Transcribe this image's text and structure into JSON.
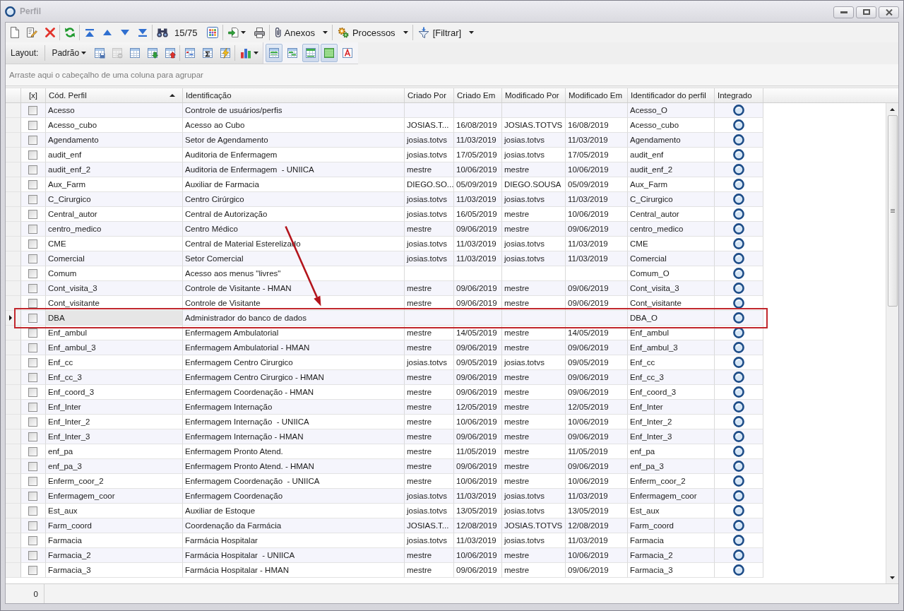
{
  "window": {
    "title": "Perfil"
  },
  "toolbar": {
    "counter": "15/75",
    "menus": [
      {
        "kind": "attachments",
        "label": "Anexos"
      },
      {
        "kind": "processes",
        "label": "Processos"
      },
      {
        "kind": "filter",
        "label": "[Filtrar]"
      }
    ]
  },
  "layout_bar": {
    "label": "Layout:",
    "layout": "Padrão",
    "tools": [
      {
        "kind": "save",
        "disabled": false
      },
      {
        "kind": "remove",
        "disabled": true
      },
      {
        "kind": "table",
        "disabled": false
      },
      {
        "kind": "import",
        "disabled": false
      },
      {
        "kind": "export",
        "disabled": false
      }
    ],
    "view_toggles": [
      {
        "kind": "grid",
        "pressed": true
      },
      {
        "kind": "bands",
        "pressed": false
      },
      {
        "kind": "header",
        "pressed": true
      },
      {
        "kind": "fill",
        "pressed": true
      },
      {
        "kind": "font",
        "pressed": false
      }
    ]
  },
  "group_panel": {
    "hint": "Arraste aqui o cabeçalho de uma coluna para agrupar"
  },
  "grid": {
    "columns": [
      {
        "label": "[x]",
        "sorted": false
      },
      {
        "label": "Cód. Perfil",
        "sorted": true
      },
      {
        "label": "Identificação",
        "sorted": false
      },
      {
        "label": "Criado Por",
        "sorted": false
      },
      {
        "label": "Criado Em",
        "sorted": false
      },
      {
        "label": "Modificado Por",
        "sorted": false
      },
      {
        "label": "Modificado Em",
        "sorted": false
      },
      {
        "label": "Identificador do perfil",
        "sorted": false
      },
      {
        "label": "Integrado",
        "sorted": false
      }
    ],
    "rows": [
      {
        "code": "Acesso",
        "name": "Controle de usuários/perfis",
        "profile_id": "Acesso_O",
        "checked": false,
        "integrated": true,
        "selected": false,
        "highlighted": false
      },
      {
        "code": "Acesso_cubo",
        "name": "Acesso ao Cubo",
        "created_by": "JOSIAS.T...",
        "created_on": "16/08/2019",
        "modified_by": "JOSIAS.TOTVS",
        "modified_on": "16/08/2019",
        "profile_id": "Acesso_cubo",
        "checked": false,
        "integrated": true,
        "selected": false,
        "highlighted": false
      },
      {
        "code": "Agendamento",
        "name": "Setor de Agendamento",
        "created_by": "josias.totvs",
        "created_on": "11/03/2019",
        "modified_by": "josias.totvs",
        "modified_on": "11/03/2019",
        "profile_id": "Agendamento",
        "checked": false,
        "integrated": true,
        "selected": false,
        "highlighted": false
      },
      {
        "code": "audit_enf",
        "name": "Auditoria de Enfermagem",
        "created_by": "josias.totvs",
        "created_on": "17/05/2019",
        "modified_by": "josias.totvs",
        "modified_on": "17/05/2019",
        "profile_id": "audit_enf",
        "checked": false,
        "integrated": true,
        "selected": false,
        "highlighted": false
      },
      {
        "code": "audit_enf_2",
        "name": "Auditoria de Enfermagem  - UNIICA",
        "created_by": "mestre",
        "created_on": "10/06/2019",
        "modified_by": "mestre",
        "modified_on": "10/06/2019",
        "profile_id": "audit_enf_2",
        "checked": false,
        "integrated": true,
        "selected": false,
        "highlighted": false
      },
      {
        "code": "Aux_Farm",
        "name": "Auxiliar de Farmacia",
        "created_by": "DIEGO.SO...",
        "created_on": "05/09/2019",
        "modified_by": "DIEGO.SOUSA",
        "modified_on": "05/09/2019",
        "profile_id": "Aux_Farm",
        "checked": false,
        "integrated": true,
        "selected": false,
        "highlighted": false
      },
      {
        "code": "C_Cirurgico",
        "name": "Centro Cirúrgico",
        "created_by": "josias.totvs",
        "created_on": "11/03/2019",
        "modified_by": "josias.totvs",
        "modified_on": "11/03/2019",
        "profile_id": "C_Cirurgico",
        "checked": false,
        "integrated": true,
        "selected": false,
        "highlighted": false
      },
      {
        "code": "Central_autor",
        "name": "Central de Autorização",
        "created_by": "josias.totvs",
        "created_on": "16/05/2019",
        "modified_by": "mestre",
        "modified_on": "10/06/2019",
        "profile_id": "Central_autor",
        "checked": false,
        "integrated": true,
        "selected": false,
        "highlighted": false
      },
      {
        "code": "centro_medico",
        "name": "Centro Médico",
        "created_by": "mestre",
        "created_on": "09/06/2019",
        "modified_by": "mestre",
        "modified_on": "09/06/2019",
        "profile_id": "centro_medico",
        "checked": false,
        "integrated": true,
        "selected": false,
        "highlighted": false
      },
      {
        "code": "CME",
        "name": "Central de Material Esterelizado",
        "created_by": "josias.totvs",
        "created_on": "11/03/2019",
        "modified_by": "josias.totvs",
        "modified_on": "11/03/2019",
        "profile_id": "CME",
        "checked": false,
        "integrated": true,
        "selected": false,
        "highlighted": false
      },
      {
        "code": "Comercial",
        "name": "Setor Comercial",
        "created_by": "josias.totvs",
        "created_on": "11/03/2019",
        "modified_by": "josias.totvs",
        "modified_on": "11/03/2019",
        "profile_id": "Comercial",
        "checked": false,
        "integrated": true,
        "selected": false,
        "highlighted": false
      },
      {
        "code": "Comum",
        "name": "Acesso aos menus \"livres\"",
        "profile_id": "Comum_O",
        "checked": false,
        "integrated": true,
        "selected": false,
        "highlighted": false
      },
      {
        "code": "Cont_visita_3",
        "name": "Controle de Visitante - HMAN",
        "created_by": "mestre",
        "created_on": "09/06/2019",
        "modified_by": "mestre",
        "modified_on": "09/06/2019",
        "profile_id": "Cont_visita_3",
        "checked": false,
        "integrated": true,
        "selected": false,
        "highlighted": false
      },
      {
        "code": "Cont_visitante",
        "name": "Controle de Visitante",
        "created_by": "mestre",
        "created_on": "09/06/2019",
        "modified_by": "mestre",
        "modified_on": "09/06/2019",
        "profile_id": "Cont_visitante",
        "checked": false,
        "integrated": true,
        "selected": false,
        "highlighted": false
      },
      {
        "code": "DBA",
        "name": "Administrador do banco de dados",
        "profile_id": "DBA_O",
        "checked": false,
        "integrated": true,
        "selected": true,
        "highlighted": true
      },
      {
        "code": "Enf_ambul",
        "name": "Enfermagem Ambulatorial",
        "created_by": "mestre",
        "created_on": "14/05/2019",
        "modified_by": "mestre",
        "modified_on": "14/05/2019",
        "profile_id": "Enf_ambul",
        "checked": false,
        "integrated": true,
        "selected": false,
        "highlighted": false
      },
      {
        "code": "Enf_ambul_3",
        "name": "Enfermagem Ambulatorial - HMAN",
        "created_by": "mestre",
        "created_on": "09/06/2019",
        "modified_by": "mestre",
        "modified_on": "09/06/2019",
        "profile_id": "Enf_ambul_3",
        "checked": false,
        "integrated": true,
        "selected": false,
        "highlighted": false
      },
      {
        "code": "Enf_cc",
        "name": "Enfermagem Centro Cirurgico",
        "created_by": "josias.totvs",
        "created_on": "09/05/2019",
        "modified_by": "josias.totvs",
        "modified_on": "09/05/2019",
        "profile_id": "Enf_cc",
        "checked": false,
        "integrated": true,
        "selected": false,
        "highlighted": false
      },
      {
        "code": "Enf_cc_3",
        "name": "Enfermagem Centro Cirurgico - HMAN",
        "created_by": "mestre",
        "created_on": "09/06/2019",
        "modified_by": "mestre",
        "modified_on": "09/06/2019",
        "profile_id": "Enf_cc_3",
        "checked": false,
        "integrated": true,
        "selected": false,
        "highlighted": false
      },
      {
        "code": "Enf_coord_3",
        "name": "Enfermagem Coordenação - HMAN",
        "created_by": "mestre",
        "created_on": "09/06/2019",
        "modified_by": "mestre",
        "modified_on": "09/06/2019",
        "profile_id": "Enf_coord_3",
        "checked": false,
        "integrated": true,
        "selected": false,
        "highlighted": false
      },
      {
        "code": "Enf_Inter",
        "name": "Enfermagem Internação",
        "created_by": "mestre",
        "created_on": "12/05/2019",
        "modified_by": "mestre",
        "modified_on": "12/05/2019",
        "profile_id": "Enf_Inter",
        "checked": false,
        "integrated": true,
        "selected": false,
        "highlighted": false
      },
      {
        "code": "Enf_Inter_2",
        "name": "Enfermagem Internação  - UNIICA",
        "created_by": "mestre",
        "created_on": "10/06/2019",
        "modified_by": "mestre",
        "modified_on": "10/06/2019",
        "profile_id": "Enf_Inter_2",
        "checked": false,
        "integrated": true,
        "selected": false,
        "highlighted": false
      },
      {
        "code": "Enf_Inter_3",
        "name": "Enfermagem Internação - HMAN",
        "created_by": "mestre",
        "created_on": "09/06/2019",
        "modified_by": "mestre",
        "modified_on": "09/06/2019",
        "profile_id": "Enf_Inter_3",
        "checked": false,
        "integrated": true,
        "selected": false,
        "highlighted": false
      },
      {
        "code": "enf_pa",
        "name": "Enfermagem Pronto Atend.",
        "created_by": "mestre",
        "created_on": "11/05/2019",
        "modified_by": "mestre",
        "modified_on": "11/05/2019",
        "profile_id": "enf_pa",
        "checked": false,
        "integrated": true,
        "selected": false,
        "highlighted": false
      },
      {
        "code": "enf_pa_3",
        "name": "Enfermagem Pronto Atend. - HMAN",
        "created_by": "mestre",
        "created_on": "09/06/2019",
        "modified_by": "mestre",
        "modified_on": "09/06/2019",
        "profile_id": "enf_pa_3",
        "checked": false,
        "integrated": true,
        "selected": false,
        "highlighted": false
      },
      {
        "code": "Enferm_coor_2",
        "name": "Enfermagem Coordenação  - UNIICA",
        "created_by": "mestre",
        "created_on": "10/06/2019",
        "modified_by": "mestre",
        "modified_on": "10/06/2019",
        "profile_id": "Enferm_coor_2",
        "checked": false,
        "integrated": true,
        "selected": false,
        "highlighted": false
      },
      {
        "code": "Enfermagem_coor",
        "name": "Enfermagem Coordenação",
        "created_by": "josias.totvs",
        "created_on": "11/03/2019",
        "modified_by": "josias.totvs",
        "modified_on": "11/03/2019",
        "profile_id": "Enfermagem_coor",
        "checked": false,
        "integrated": true,
        "selected": false,
        "highlighted": false
      },
      {
        "code": "Est_aux",
        "name": "Auxiliar de Estoque",
        "created_by": "josias.totvs",
        "created_on": "13/05/2019",
        "modified_by": "josias.totvs",
        "modified_on": "13/05/2019",
        "profile_id": "Est_aux",
        "checked": false,
        "integrated": true,
        "selected": false,
        "highlighted": false
      },
      {
        "code": "Farm_coord",
        "name": "Coordenação da Farmácia",
        "created_by": "JOSIAS.T...",
        "created_on": "12/08/2019",
        "modified_by": "JOSIAS.TOTVS",
        "modified_on": "12/08/2019",
        "profile_id": "Farm_coord",
        "checked": false,
        "integrated": true,
        "selected": false,
        "highlighted": false
      },
      {
        "code": "Farmacia",
        "name": "Farmácia Hospitalar",
        "created_by": "josias.totvs",
        "created_on": "11/03/2019",
        "modified_by": "josias.totvs",
        "modified_on": "11/03/2019",
        "profile_id": "Farmacia",
        "checked": false,
        "integrated": true,
        "selected": false,
        "highlighted": false
      },
      {
        "code": "Farmacia_2",
        "name": "Farmácia Hospitalar  - UNIICA",
        "created_by": "mestre",
        "created_on": "10/06/2019",
        "modified_by": "mestre",
        "modified_on": "10/06/2019",
        "profile_id": "Farmacia_2",
        "checked": false,
        "integrated": true,
        "selected": false,
        "highlighted": false
      },
      {
        "code": "Farmacia_3",
        "name": "Farmácia Hospitalar - HMAN",
        "created_by": "mestre",
        "created_on": "09/06/2019",
        "modified_by": "mestre",
        "modified_on": "09/06/2019",
        "profile_id": "Farmacia_3",
        "checked": false,
        "integrated": true,
        "selected": false,
        "highlighted": false
      }
    ]
  },
  "footer": {
    "summary": "0"
  }
}
